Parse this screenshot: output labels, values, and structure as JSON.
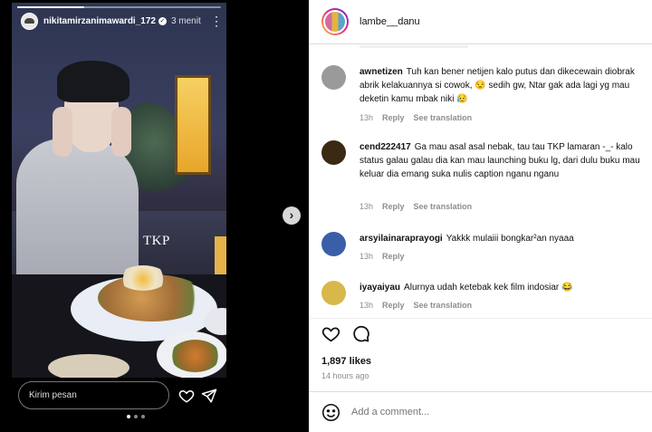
{
  "story": {
    "username": "nikitamirzanimawardi_172",
    "time": "3 menit",
    "overlay_text": "TKP",
    "reply_placeholder": "Kirim pesan",
    "progress": 0.33,
    "page_dots": 3,
    "active_dot": 0
  },
  "post": {
    "username": "lambe__danu",
    "likes": "1,897 likes",
    "time_ago": "14 hours ago",
    "add_comment_placeholder": "Add a comment..."
  },
  "labels": {
    "reply": "Reply",
    "see_translation": "See translation"
  },
  "comments": [
    {
      "username": "awnetizen",
      "text": "Tuh kan bener netijen kalo putus dan dikecewain diobrak abrik kelakuannya si cowok, 😒 sedih gw, Ntar gak ada lagi yg mau deketin kamu mbak niki 😥",
      "time": "13h",
      "avatar_color": "#9a9a9a"
    },
    {
      "username": "cend222417",
      "text": "Ga mau asal asal nebak, tau tau TKP lamaran -_- kalo status galau galau dia kan mau launching buku lg, dari dulu buku mau keluar dia emang suka nulis caption nganu nganu",
      "time": "13h",
      "avatar_color": "#3a2a14"
    },
    {
      "username": "arsyilainaraprayogi",
      "text": "Yakkk mulaiii bongkar²an nyaaa",
      "time": "13h",
      "avatar_color": "#3a5ea8"
    },
    {
      "username": "iyayaiyau",
      "text": "Alurnya udah ketebak kek film indosiar 😂",
      "time": "13h",
      "avatar_color": "#d8b84a"
    }
  ],
  "icons": {
    "story_like": "heart-icon",
    "story_send": "send-icon",
    "next": "chevron-right-icon",
    "post_like": "heart-icon",
    "post_comment": "comment-icon",
    "emoji": "emoji-icon",
    "more": "more-vertical-icon"
  },
  "colors": {
    "panel_bg": "#ffffff",
    "muted_text": "#8e8e8e",
    "media_bg": "#000000"
  }
}
